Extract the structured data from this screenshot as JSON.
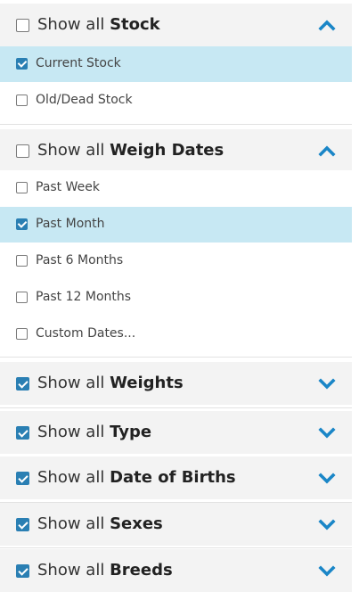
{
  "groups": [
    {
      "prefix": "Show all",
      "name": "Stock",
      "checked": false,
      "expanded": true,
      "items": [
        {
          "label": "Current Stock",
          "checked": true
        },
        {
          "label": "Old/Dead Stock",
          "checked": false
        }
      ]
    },
    {
      "prefix": "Show all",
      "name": "Weigh Dates",
      "checked": false,
      "expanded": true,
      "items": [
        {
          "label": "Past Week",
          "checked": false
        },
        {
          "label": "Past Month",
          "checked": true
        },
        {
          "label": "Past 6 Months",
          "checked": false
        },
        {
          "label": "Past 12 Months",
          "checked": false
        },
        {
          "label": "Custom Dates...",
          "checked": false
        }
      ]
    },
    {
      "prefix": "Show all",
      "name": "Weights",
      "checked": true,
      "expanded": false,
      "items": []
    },
    {
      "prefix": "Show all",
      "name": "Type",
      "checked": true,
      "expanded": false,
      "items": []
    },
    {
      "prefix": "Show all",
      "name": "Date of Births",
      "checked": true,
      "expanded": false,
      "items": []
    },
    {
      "prefix": "Show all",
      "name": "Sexes",
      "checked": true,
      "expanded": false,
      "items": []
    },
    {
      "prefix": "Show all",
      "name": "Breeds",
      "checked": true,
      "expanded": false,
      "items": []
    }
  ],
  "colors": {
    "accent": "#2a7fb3",
    "chevron": "#1a86c7",
    "selected_row": "#c7e8f3",
    "header_bg": "#f3f3f3"
  }
}
